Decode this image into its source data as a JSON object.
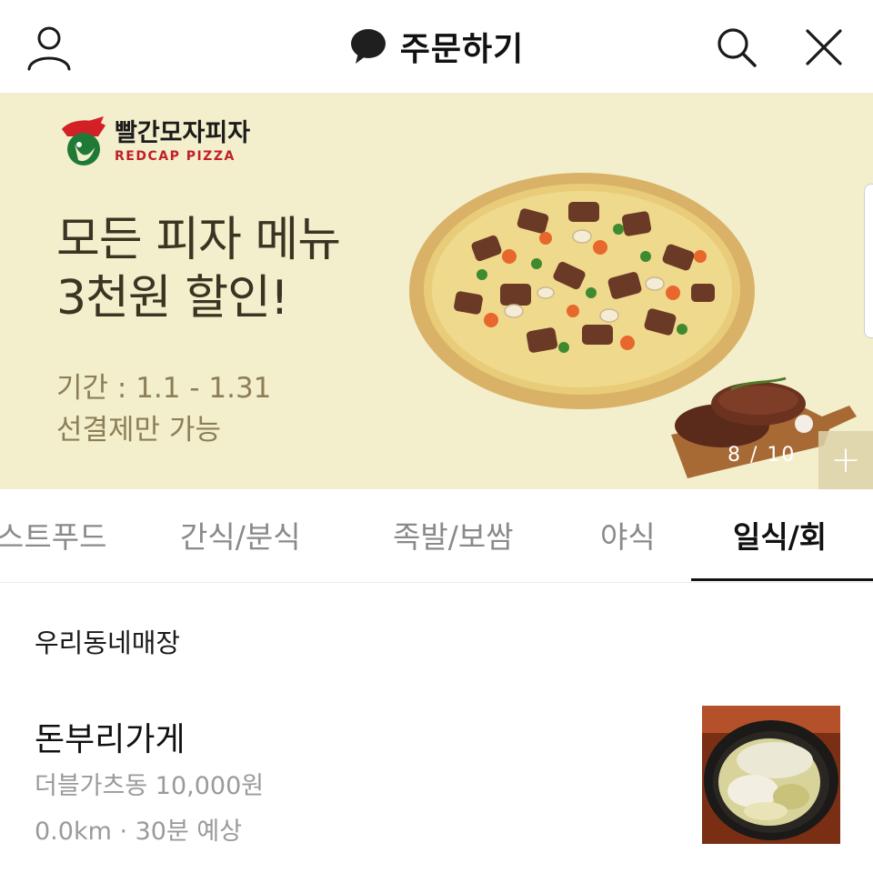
{
  "header": {
    "title": "주문하기",
    "icons": {
      "left": "profile-icon",
      "title": "chat-bubble-icon",
      "search": "search-icon",
      "close": "close-icon"
    }
  },
  "banner": {
    "brand_name": "빨간모자피자",
    "brand_sub": "REDCAP PIZZA",
    "headline_line1": "모든 피자 메뉴",
    "headline_line2": "3천원 할인!",
    "period": "기간 : 1.1 - 1.31",
    "note": "선결제만 가능",
    "page_indicator": "8 / 10",
    "plus_label": "+",
    "colors": {
      "background": "#f3eecb",
      "headline": "#3a3523",
      "subtext": "#8c7f57",
      "brand_red": "#c0202a"
    }
  },
  "tabs": {
    "items": [
      {
        "label": "스트푸드",
        "active": false
      },
      {
        "label": "간식/분식",
        "active": false
      },
      {
        "label": "족발/보쌈",
        "active": false
      },
      {
        "label": "야식",
        "active": false
      },
      {
        "label": "일식/회",
        "active": true
      }
    ]
  },
  "section": {
    "title": "우리동네매장"
  },
  "stores": [
    {
      "name": "돈부리가게",
      "menu": "더블가츠동  10,000원",
      "meta": "0.0km · 30분 예상"
    }
  ]
}
